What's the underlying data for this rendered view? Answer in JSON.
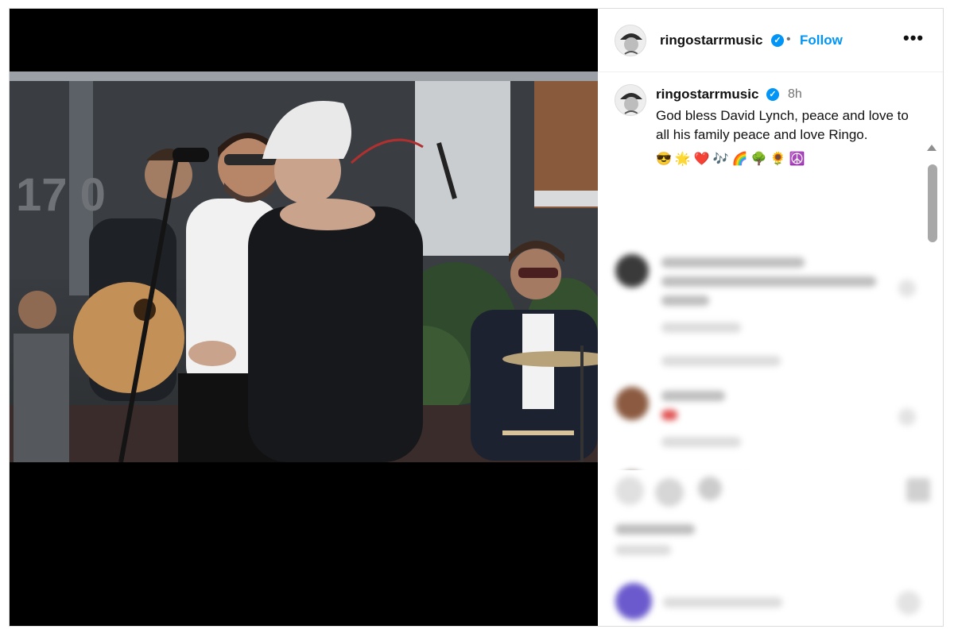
{
  "post": {
    "username": "ringostarrmusic",
    "follow_label": "Follow",
    "more_label": "•••",
    "separator": "•",
    "verified_mark": "✓"
  },
  "caption": {
    "username": "ringostarrmusic",
    "time": "8h",
    "text": "God bless David Lynch, peace and love to all his family peace and love Ringo.",
    "emojis": "😎🌟❤️🎶🌈🌳🌻☮️"
  },
  "icons": {
    "verified": "verified-badge-icon",
    "more": "more-options-icon",
    "scroll_up": "chevron-up-icon"
  },
  "colors": {
    "accent": "#0095f6",
    "media_bg": "#000000",
    "secondary_text": "#737373"
  }
}
